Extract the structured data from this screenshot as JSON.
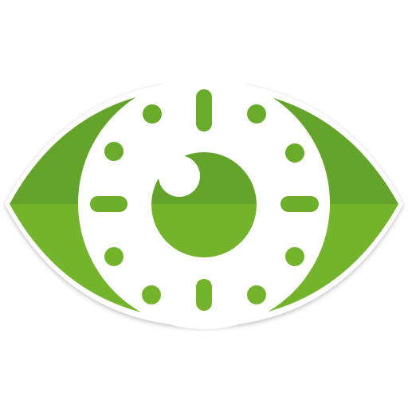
{
  "icon": {
    "name": "eye-timer-icon",
    "colors": {
      "green_upper": "#64A42B",
      "green_lower": "#74B42C",
      "white": "#FFFFFF",
      "highlight": "#FFFFFF"
    },
    "clock_marks": 12
  }
}
